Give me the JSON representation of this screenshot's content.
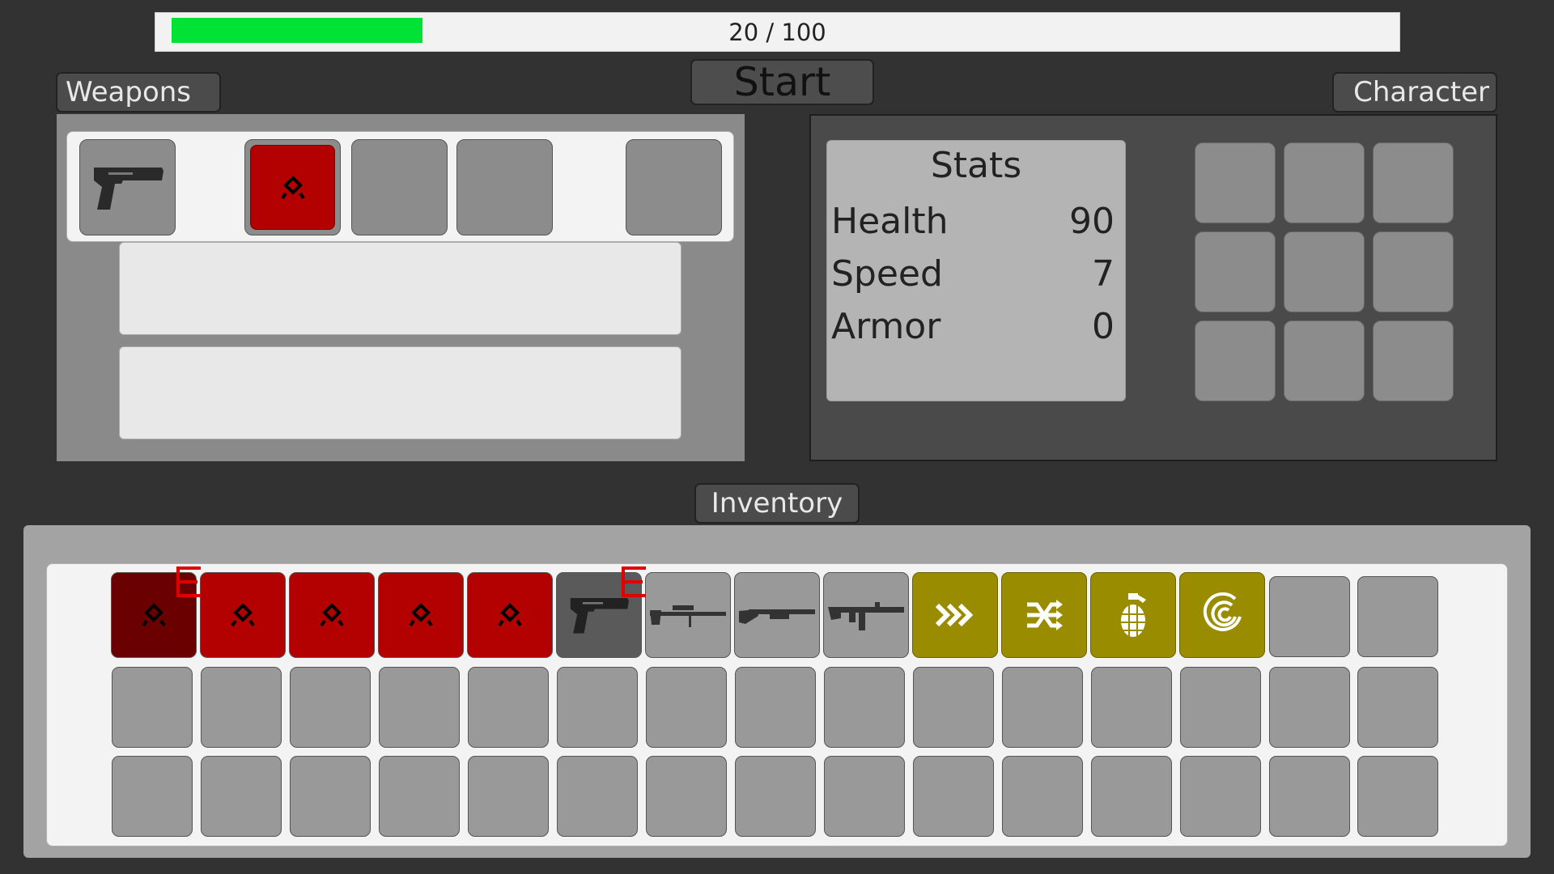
{
  "progress": {
    "text": "20 / 100",
    "fill_fraction": 0.2,
    "fill_color": "#00e235"
  },
  "tabs": {
    "weapons": "Weapons",
    "start": "Start",
    "character": "Character",
    "inventory": "Inventory"
  },
  "weapons_panel": {
    "slots": [
      {
        "icon": "pistol-icon"
      },
      {
        "icon": "ring-rune-icon",
        "selected": true,
        "color": "#b30000"
      },
      {
        "icon": null
      },
      {
        "icon": null
      },
      {
        "icon": null
      }
    ]
  },
  "stats": {
    "title": "Stats",
    "rows": [
      {
        "label": "Health",
        "value": "90"
      },
      {
        "label": "Speed",
        "value": "7"
      },
      {
        "label": "Armor",
        "value": "0"
      }
    ]
  },
  "inventory": {
    "rows": 3,
    "cols": 15,
    "hotkey_marks": 2,
    "items": [
      {
        "icon": "ring-rune-icon",
        "color": "#6a0000"
      },
      {
        "icon": "ring-rune-icon",
        "color": "#b30000"
      },
      {
        "icon": "ring-rune-icon",
        "color": "#b30000"
      },
      {
        "icon": "ring-rune-icon",
        "color": "#b30000"
      },
      {
        "icon": "ring-rune-icon",
        "color": "#b30000"
      },
      {
        "icon": "pistol-icon",
        "color": "#5a5a5a"
      },
      {
        "icon": "sniper-rifle-icon",
        "color": "#999999"
      },
      {
        "icon": "shotgun-icon",
        "color": "#999999"
      },
      {
        "icon": "assault-rifle-icon",
        "color": "#999999"
      },
      {
        "icon": "speed-chevrons-icon",
        "color": "#9a8c00"
      },
      {
        "icon": "shuffle-icon",
        "color": "#9a8c00"
      },
      {
        "icon": "grenade-icon",
        "color": "#9a8c00"
      },
      {
        "icon": "vortex-icon",
        "color": "#9a8c00"
      }
    ]
  }
}
